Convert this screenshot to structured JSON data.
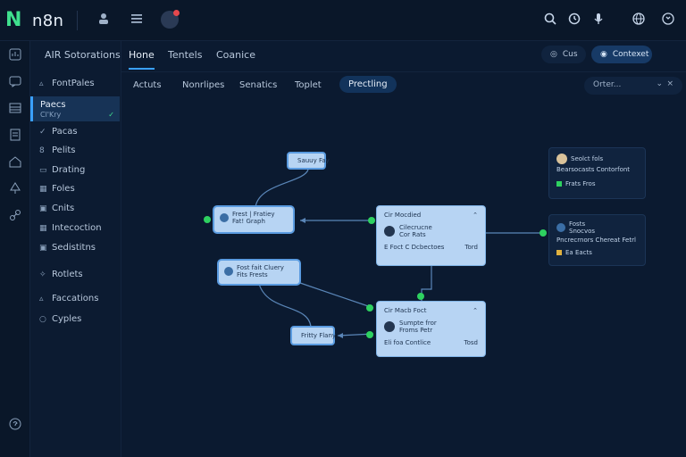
{
  "app": {
    "logo_mark": "N",
    "logo_text": "n8n"
  },
  "topbar": {
    "icons": [
      "user-icon",
      "menu-icon",
      "notification-avatar",
      "search-icon",
      "clock-icon",
      "mic-icon",
      "globe-icon",
      "refresh-icon"
    ]
  },
  "rail": {
    "icons": [
      "dashboard-icon",
      "chat-icon",
      "table-icon",
      "document-icon",
      "home-icon",
      "tree-icon",
      "link-icon",
      "help-icon"
    ]
  },
  "sidebar": {
    "items": [
      {
        "label": "FontPales",
        "icon": "triangle"
      },
      {
        "label": "Paecs",
        "icon": "circle"
      },
      {
        "label": "Pacas",
        "icon": "check"
      },
      {
        "label": "Pelits",
        "icon": "hash"
      },
      {
        "label": "Drating",
        "icon": "doc"
      },
      {
        "label": "Foles",
        "icon": "grid"
      },
      {
        "label": "Cnits",
        "icon": "box"
      },
      {
        "label": "Intecoction",
        "icon": "grid"
      },
      {
        "label": "Sedistitns",
        "icon": "box"
      },
      {
        "label": "Rotlets",
        "icon": "spark"
      },
      {
        "label": "Faccations",
        "icon": "triangle"
      },
      {
        "label": "Cyples",
        "icon": "circle"
      }
    ],
    "active": {
      "title": "Paecs",
      "subtitle": "Cl'Kry"
    }
  },
  "tabs_primary": [
    {
      "label": "AIR Sotorations"
    },
    {
      "label": "Hone",
      "active": true
    },
    {
      "label": "Tentels"
    },
    {
      "label": "Coanice"
    }
  ],
  "header_buttons": [
    {
      "label": "Cus",
      "icon": "eye-icon"
    },
    {
      "label": "Contexet",
      "icon": "badge-icon"
    }
  ],
  "tabs_secondary": [
    {
      "label": "Actuts"
    },
    {
      "label": "Nonrlipes"
    },
    {
      "label": "Senatics"
    },
    {
      "label": "Toplet"
    },
    {
      "label": "Prectling",
      "active": true
    }
  ],
  "filter": {
    "label": "Orter...",
    "chevron": "⌄",
    "close": "×"
  },
  "nodes": {
    "n1": {
      "label": "Sauuy Fay"
    },
    "n2": {
      "title": "Frest | Fratiey",
      "subtitle": "Fat! Graph"
    },
    "n3": {
      "title": "Fost fait Cluery",
      "subtitle": "Fits Frests"
    },
    "n4": {
      "label": "Fritty Flany"
    },
    "n5": {
      "title": "Cir Mocdied",
      "line1": "Cilecrucne",
      "line2": "Cor Rats",
      "bottom_left": "E Foct  C  Dcbectoes",
      "bottom_right": "Tord",
      "chevron": "⌃"
    },
    "n6": {
      "title": "Cir Macb Foct",
      "line1": "Sumpte fror",
      "line2": "Froms Petr",
      "bottom_left": "Eli foa Contlice",
      "bottom_right": "Tosd",
      "chevron": "⌃"
    },
    "r1": {
      "title": "Seolct fols",
      "subtitle": "Bearsocasts Contorfont",
      "button": "Frats Fros"
    },
    "r2": {
      "title": "Fosts",
      "subtitle": "Snocvos",
      "line2": "Pncrecrnors Chereat Fetrl",
      "button": "Ea Eacts"
    }
  },
  "colors": {
    "accent": "#3aa0ff",
    "success": "#2ed160",
    "node_fill": "#b7d4f3",
    "bg": "#0b1a30"
  }
}
